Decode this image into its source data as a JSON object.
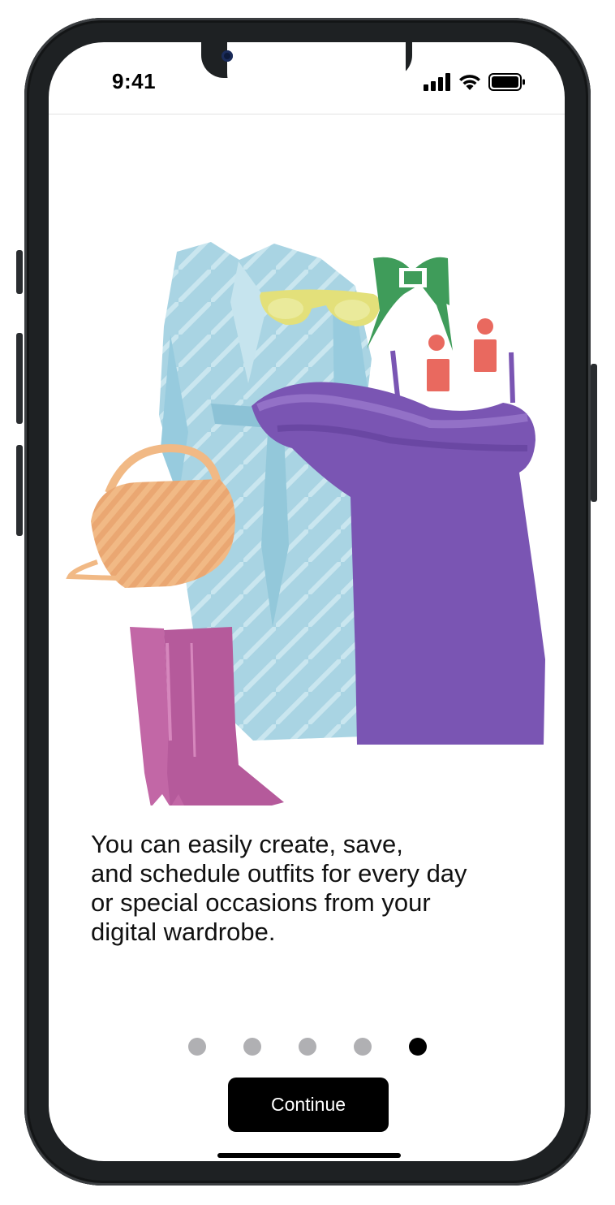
{
  "status_bar": {
    "time": "9:41",
    "signal_icon": "cellular-signal-icon",
    "wifi_icon": "wifi-icon",
    "battery_icon": "battery-icon"
  },
  "illustration": {
    "items": [
      "coat",
      "sunglasses",
      "hair-bow",
      "earrings",
      "dress",
      "handbag",
      "boots"
    ],
    "colors": {
      "coat": "#a9d4e3",
      "sunglasses": "#e3e07a",
      "bow": "#3f9c5a",
      "earrings": "#e9695f",
      "dress": "#7a55b3",
      "handbag": "#f1b985",
      "boots": "#c267a6"
    }
  },
  "onboarding": {
    "description": "You can easily create, save,\nand schedule outfits for every day\nor special occasions from your\ndigital wardrobe.",
    "page_count": 5,
    "current_page": 5
  },
  "continue_button": {
    "label": "Continue"
  }
}
